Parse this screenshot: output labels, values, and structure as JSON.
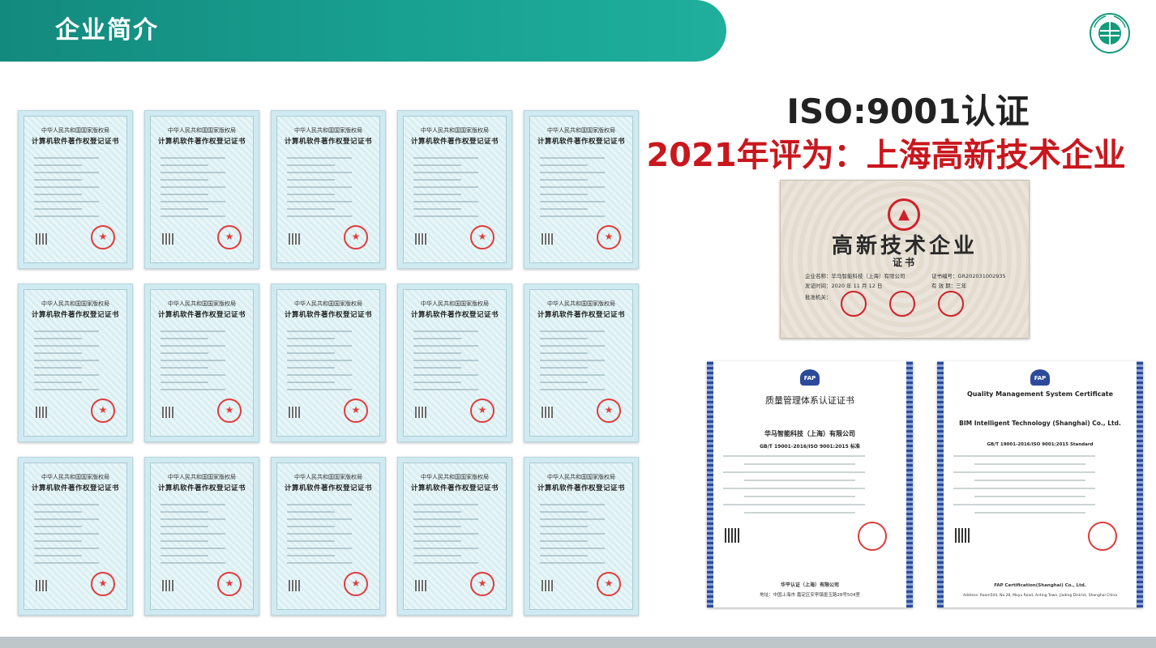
{
  "header": {
    "title": "企业简介",
    "logo_icon": "state-grid-logo-icon"
  },
  "headline": {
    "iso": "ISO:9001认证",
    "award": "2021年评为：上海高新技术企业"
  },
  "colors": {
    "header_teal": "#18a090",
    "award_red": "#c9171e",
    "seal_red": "#e23b3b",
    "iso_blue": "#2c4a9a"
  },
  "software_certificates": {
    "issuer": "中华人民共和国国家版权局",
    "title": "计算机软件著作权登记证书"
  },
  "hitech_certificate": {
    "title": "高新技术企业",
    "subtitle": "证书",
    "company_line": "企业名称：华马智能科技（上海）有限公司",
    "cert_no_line": "证书编号：GR202031002935",
    "date_line": "发证时间：2020 年 11 月 12 日",
    "valid_line": "有 效 期：三年",
    "approver_line": "批准机关："
  },
  "iso_cn_certificate": {
    "logo": "FAP",
    "title": "质量管理体系认证证书",
    "company": "华马智能科技（上海）有限公司",
    "standard": "GB/T 19001-2016/ISO 9001:2015 标准",
    "footer_org": "华平认证（上海）有限公司",
    "footer_addr": "地址：中国上海市 嘉定区安亭镇墨玉路28号504室"
  },
  "iso_en_certificate": {
    "logo": "FAP",
    "title": "Quality Management System Certificate",
    "company": "BIM Intelligent Technology (Shanghai) Co., Ltd.",
    "standard": "GB/T 19001-2016/ISO 9001:2015 Standard",
    "footer_org": "FAP Certification(Shanghai) Co., Ltd.",
    "footer_addr": "Address: Room504, No.28, Moyu Road, Anting Town, Jiading District, Shanghai China"
  }
}
